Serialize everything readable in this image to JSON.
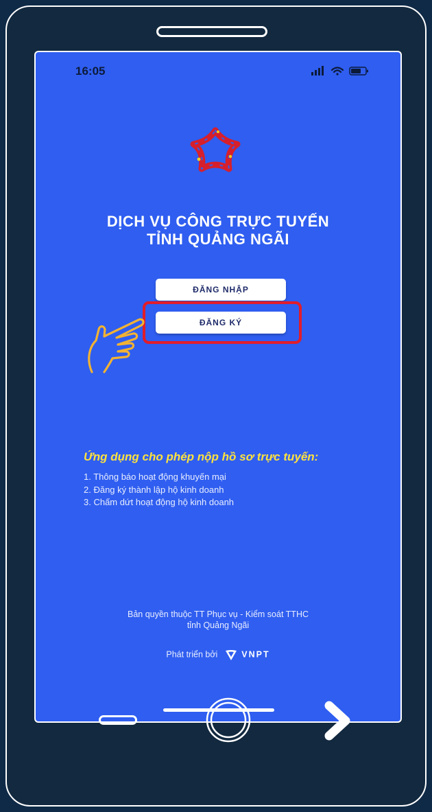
{
  "status_bar": {
    "time": "16:05"
  },
  "app": {
    "title_line1": "DỊCH VỤ CÔNG TRỰC TUYẾN",
    "title_line2": "TỈNH QUẢNG NGÃI",
    "login_label": "ĐĂNG NHẬP",
    "register_label": "ĐĂNG KÝ"
  },
  "info": {
    "heading": "Ứng dụng cho phép nộp hồ sơ trực tuyến:",
    "items": [
      "1. Thông báo hoạt động khuyến mại",
      "2. Đăng ký thành lập hộ kinh doanh",
      "3. Chấm dứt hoạt động hộ kinh doanh"
    ]
  },
  "footer": {
    "copyright_line1": "Bản quyền thuộc TT Phục vụ - Kiểm soát TTHC",
    "copyright_line2": "tỉnh Quảng Ngãi",
    "developed_by": "Phát triển bởi",
    "brand": "VNPT"
  },
  "icons": {
    "logo": "national-star-logo",
    "pointer": "pointing-hand-icon",
    "nav_back": "back-bar-icon",
    "nav_home": "home-circle-icon",
    "nav_forward": "chevron-right-icon"
  },
  "colors": {
    "screen_bg": "#2f5ef0",
    "frame_bg": "#12293f",
    "highlight": "#e11d2b",
    "info_heading": "#ffe23d",
    "hand": "#f2b233"
  }
}
